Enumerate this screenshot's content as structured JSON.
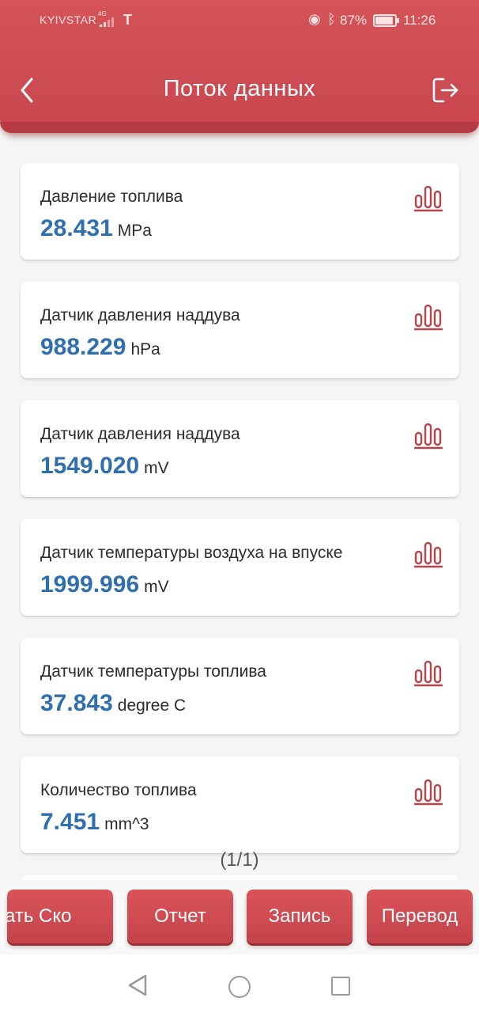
{
  "status_bar": {
    "carrier": "KYIVSTAR",
    "network_type": "4G",
    "operator_logo": "T",
    "battery": "87%",
    "time": "11:26"
  },
  "header": {
    "title": "Поток данных",
    "back_icon": "chevron-left-icon",
    "exit_icon": "exit-icon"
  },
  "items": [
    {
      "name": "Давление топлива",
      "value": "28.431",
      "unit": "MPa"
    },
    {
      "name": "Датчик давления наддува",
      "value": "988.229",
      "unit": "hPa"
    },
    {
      "name": "Датчик давления наддува",
      "value": "1549.020",
      "unit": "mV"
    },
    {
      "name": "Датчик температуры воздуха на впуске",
      "value": "1999.996",
      "unit": "mV"
    },
    {
      "name": "Датчик температуры топлива",
      "value": "37.843",
      "unit": "degree C"
    },
    {
      "name": "Количество топлива",
      "value": "7.451",
      "unit": "mm^3"
    }
  ],
  "pagination": "(1/1)",
  "bottom_buttons": {
    "first": "зать   Ско",
    "report": "Отчет",
    "record": "Запись",
    "translate": "Перевод"
  },
  "colors": {
    "accent": "#c8454c",
    "value_blue": "#2f6fb0",
    "graph_icon": "#b8444a"
  }
}
